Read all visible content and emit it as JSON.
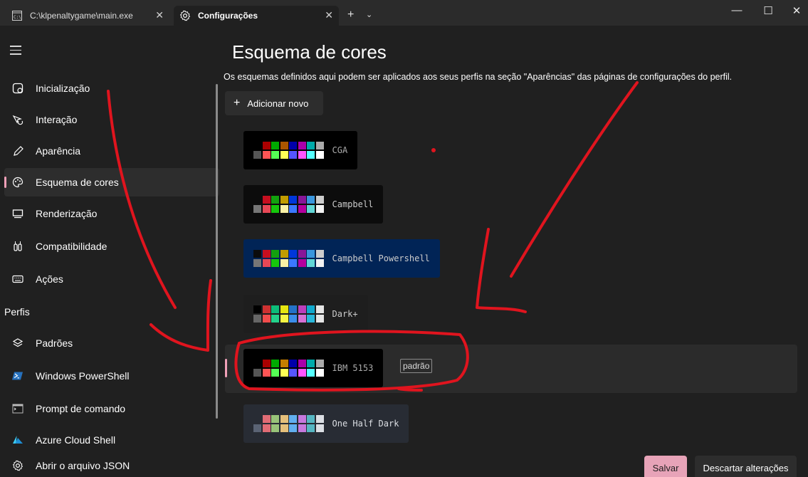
{
  "tabs": [
    {
      "title": "C:\\klpenaltygame\\main.exe",
      "icon": "console-icon",
      "close": "✕"
    },
    {
      "title": "Configurações",
      "icon": "gear-icon",
      "close": "✕"
    }
  ],
  "titlebar": {
    "new_tab": "+",
    "dropdown": "⌄",
    "minimize": "—",
    "maximize": "☐",
    "close": "✕"
  },
  "sidebar": {
    "items": [
      {
        "label": "Inicialização",
        "icon": "startup-icon"
      },
      {
        "label": "Interação",
        "icon": "interaction-icon"
      },
      {
        "label": "Aparência",
        "icon": "pen-icon"
      },
      {
        "label": "Esquema de cores",
        "icon": "palette-icon",
        "selected": true
      },
      {
        "label": "Renderização",
        "icon": "monitor-icon"
      },
      {
        "label": "Compatibilidade",
        "icon": "compatibility-icon"
      },
      {
        "label": "Ações",
        "icon": "keyboard-icon"
      }
    ],
    "profiles_header": "Perfis",
    "profiles": [
      {
        "label": "Padrões",
        "icon": "layers-icon"
      },
      {
        "label": "Windows PowerShell",
        "icon": "powershell-icon"
      },
      {
        "label": "Prompt de comando",
        "icon": "cmd-icon"
      },
      {
        "label": "Azure Cloud Shell",
        "icon": "azure-icon"
      }
    ],
    "json_link": "Abrir o arquivo JSON"
  },
  "main": {
    "title": "Esquema de cores",
    "description": "Os esquemas definidos aqui podem ser aplicados aos seus perfis na seção \"Aparências\" das páginas de configurações do perfil.",
    "add_button": "Adicionar novo",
    "schemes": [
      {
        "name": "CGA",
        "bg": "#000000",
        "fg": "#aaaaaa",
        "top": [
          "#000000",
          "#aa0000",
          "#00aa00",
          "#aa5500",
          "#0000aa",
          "#aa00aa",
          "#00aaaa",
          "#aaaaaa"
        ],
        "bottom": [
          "#555555",
          "#ff5555",
          "#55ff55",
          "#ffff55",
          "#5555ff",
          "#ff55ff",
          "#55ffff",
          "#ffffff"
        ]
      },
      {
        "name": "Campbell",
        "bg": "#0c0c0c",
        "fg": "#cccccc",
        "top": [
          "#0c0c0c",
          "#c50f1f",
          "#13a10e",
          "#c19c00",
          "#0037da",
          "#881798",
          "#3a96dd",
          "#cccccc"
        ],
        "bottom": [
          "#767676",
          "#e74856",
          "#16c60c",
          "#f9f1a5",
          "#3b78ff",
          "#b4009e",
          "#61d6d6",
          "#f2f2f2"
        ]
      },
      {
        "name": "Campbell Powershell",
        "bg": "#012456",
        "fg": "#cccccc",
        "top": [
          "#0c0c0c",
          "#c50f1f",
          "#13a10e",
          "#c19c00",
          "#0037da",
          "#881798",
          "#3a96dd",
          "#cccccc"
        ],
        "bottom": [
          "#767676",
          "#e74856",
          "#16c60c",
          "#f9f1a5",
          "#3b78ff",
          "#b4009e",
          "#61d6d6",
          "#f2f2f2"
        ]
      },
      {
        "name": "Dark+",
        "bg": "#1e1e1e",
        "fg": "#cccccc",
        "top": [
          "#000000",
          "#cd3131",
          "#0dbc79",
          "#e5e510",
          "#2472c8",
          "#bc3fbc",
          "#11a8cd",
          "#e5e5e5"
        ],
        "bottom": [
          "#666666",
          "#f14c4c",
          "#23d18b",
          "#f5f543",
          "#3b8eea",
          "#d670d6",
          "#29b8db",
          "#e5e5e5"
        ]
      },
      {
        "name": "IBM 5153",
        "bg": "#000000",
        "fg": "#aaaaaa",
        "selected": true,
        "default_badge": "padrão",
        "top": [
          "#000000",
          "#aa0000",
          "#00aa00",
          "#c47e00",
          "#0000aa",
          "#aa00aa",
          "#00aaaa",
          "#aaaaaa"
        ],
        "bottom": [
          "#555555",
          "#ff5555",
          "#55ff55",
          "#ffff55",
          "#5555ff",
          "#ff55ff",
          "#55ffff",
          "#ffffff"
        ]
      },
      {
        "name": "One Half Dark",
        "bg": "#282c34",
        "fg": "#dcdfe4",
        "top": [
          "#282c34",
          "#e06c75",
          "#98c379",
          "#e5c07b",
          "#61afef",
          "#c678dd",
          "#56b6c2",
          "#dcdfe4"
        ],
        "bottom": [
          "#5a6374",
          "#e06c75",
          "#98c379",
          "#e5c07b",
          "#61afef",
          "#c678dd",
          "#56b6c2",
          "#dcdfe4"
        ]
      }
    ]
  },
  "footer": {
    "save": "Salvar",
    "discard": "Descartar alterações"
  },
  "colors": {
    "accent": "#e7a3b8",
    "annotation": "#e0141e",
    "background": "#202020"
  }
}
